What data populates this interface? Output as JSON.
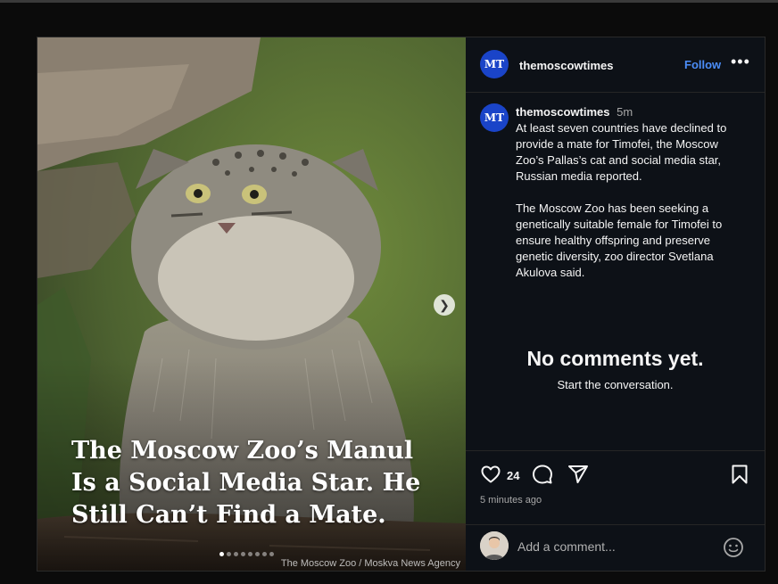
{
  "post": {
    "headline": "The Moscow Zoo’s Manul Is a Social Media Star. He Still Can’t Find a Mate.",
    "photo_credit": "The Moscow Zoo / Moskva News Agency",
    "carousel": {
      "slide_count": 8,
      "active_index": 0
    }
  },
  "account": {
    "username": "themoscowtimes",
    "avatar_initials": "MT",
    "follow_label": "Follow",
    "more_label": "•••"
  },
  "caption": {
    "username": "themoscowtimes",
    "time": "5m",
    "paragraph1": "At least seven countries have declined to provide a mate for Timofei, the Moscow Zoo’s Pallas’s cat and social media star, Russian media reported.",
    "paragraph2": "The Moscow Zoo has been seeking a genetically suitable female for Timofei to ensure healthy offspring and preserve genetic diversity, zoo director Svetlana Akulova said."
  },
  "comments": {
    "empty_title": "No comments yet.",
    "empty_subtitle": "Start the conversation."
  },
  "actions": {
    "like_count": "24",
    "posted_ago": "5 minutes ago",
    "icons": [
      "heart-icon",
      "comment-icon",
      "share-icon",
      "bookmark-icon"
    ]
  },
  "comment_box": {
    "placeholder": "Add a comment..."
  },
  "colors": {
    "accent": "#4b8df8",
    "avatar_bg": "#1a44c8",
    "panel_bg": "#0d1117"
  }
}
